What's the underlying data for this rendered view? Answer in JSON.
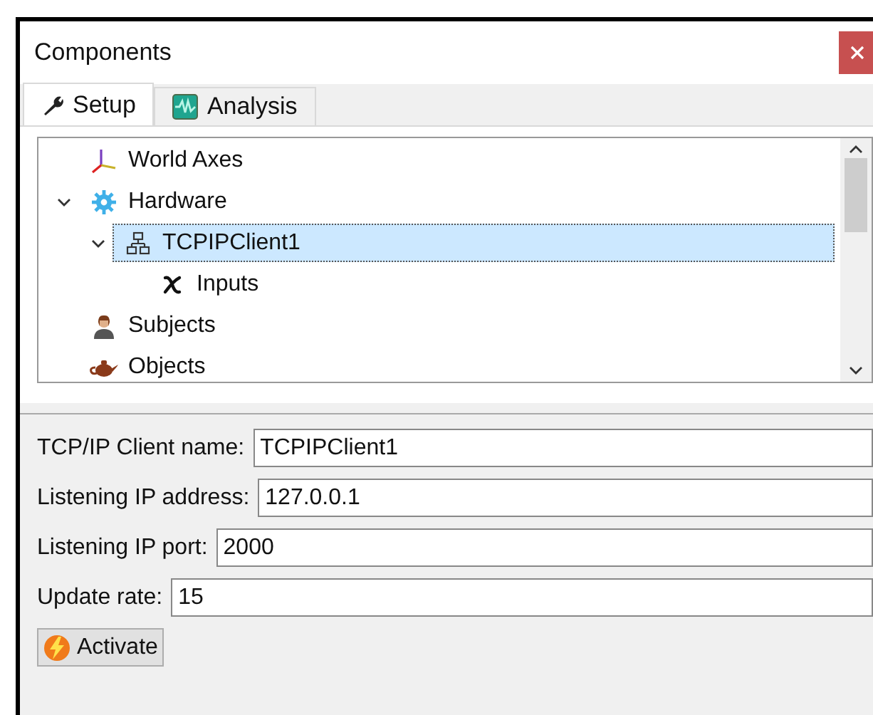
{
  "window": {
    "title": "Components"
  },
  "tabs": [
    {
      "label": "Setup",
      "kind": "wrench",
      "selected": true
    },
    {
      "label": "Analysis",
      "kind": "wave",
      "selected": false
    }
  ],
  "tree": [
    {
      "label": "World Axes",
      "kind": "axes",
      "selected": false
    },
    {
      "label": "Hardware",
      "kind": "gear",
      "selected": false,
      "expanded": true,
      "children": [
        {
          "label": "TCPIPClient1",
          "kind": "network",
          "selected": true,
          "expanded": true,
          "children": [
            {
              "label": "Inputs",
              "kind": "variable",
              "selected": false
            }
          ]
        }
      ]
    },
    {
      "label": "Subjects",
      "kind": "person",
      "selected": false
    },
    {
      "label": "Objects",
      "kind": "teapot",
      "selected": false
    }
  ],
  "form": [
    {
      "label": "TCP/IP Client name:",
      "value": "TCPIPClient1"
    },
    {
      "label": "Listening IP address:",
      "value": "127.0.0.1"
    },
    {
      "label": "Listening IP port:",
      "value": "2000"
    },
    {
      "label": "Update rate:",
      "value": "15"
    }
  ],
  "buttons": [
    {
      "label": "Activate"
    }
  ]
}
